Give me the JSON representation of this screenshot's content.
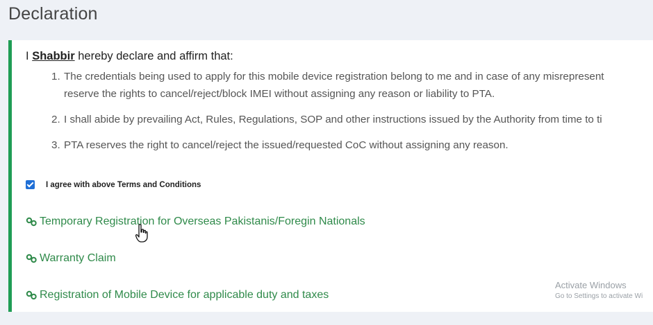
{
  "page": {
    "title": "Declaration"
  },
  "declaration": {
    "prefix": "I",
    "name": "Shabbir",
    "suffix": "hereby declare and affirm that:",
    "terms": [
      {
        "number": "1.",
        "line1": "The credentials being used to apply for this mobile device registration belong to me and in case of any misrepresent",
        "line2": "reserve the rights to cancel/reject/block IMEI without assigning any reason or liability to PTA."
      },
      {
        "number": "2.",
        "line1": "I shall abide by prevailing Act, Rules, Regulations, SOP and other instructions issued by the Authority from time to ti"
      },
      {
        "number": "3.",
        "line1": "PTA reserves the right to cancel/reject the issued/requested CoC without assigning any reason."
      }
    ],
    "agree_label": "I agree with above Terms and Conditions",
    "agree_checked": true
  },
  "links": [
    {
      "label": "Temporary Registration for Overseas Pakistanis/Foregin Nationals",
      "icon": "link-icon"
    },
    {
      "label": "Warranty Claim",
      "icon": "link-icon"
    },
    {
      "label": "Registration of Mobile Device for applicable duty and taxes",
      "icon": "link-icon"
    }
  ],
  "watermark": {
    "title": "Activate Windows",
    "subtitle": "Go to Settings to activate Wi"
  },
  "colors": {
    "accent_border": "#1f9d55",
    "link_color": "#2f8a4a",
    "checkbox": "#1f6fd6",
    "background": "#eef1f6"
  }
}
